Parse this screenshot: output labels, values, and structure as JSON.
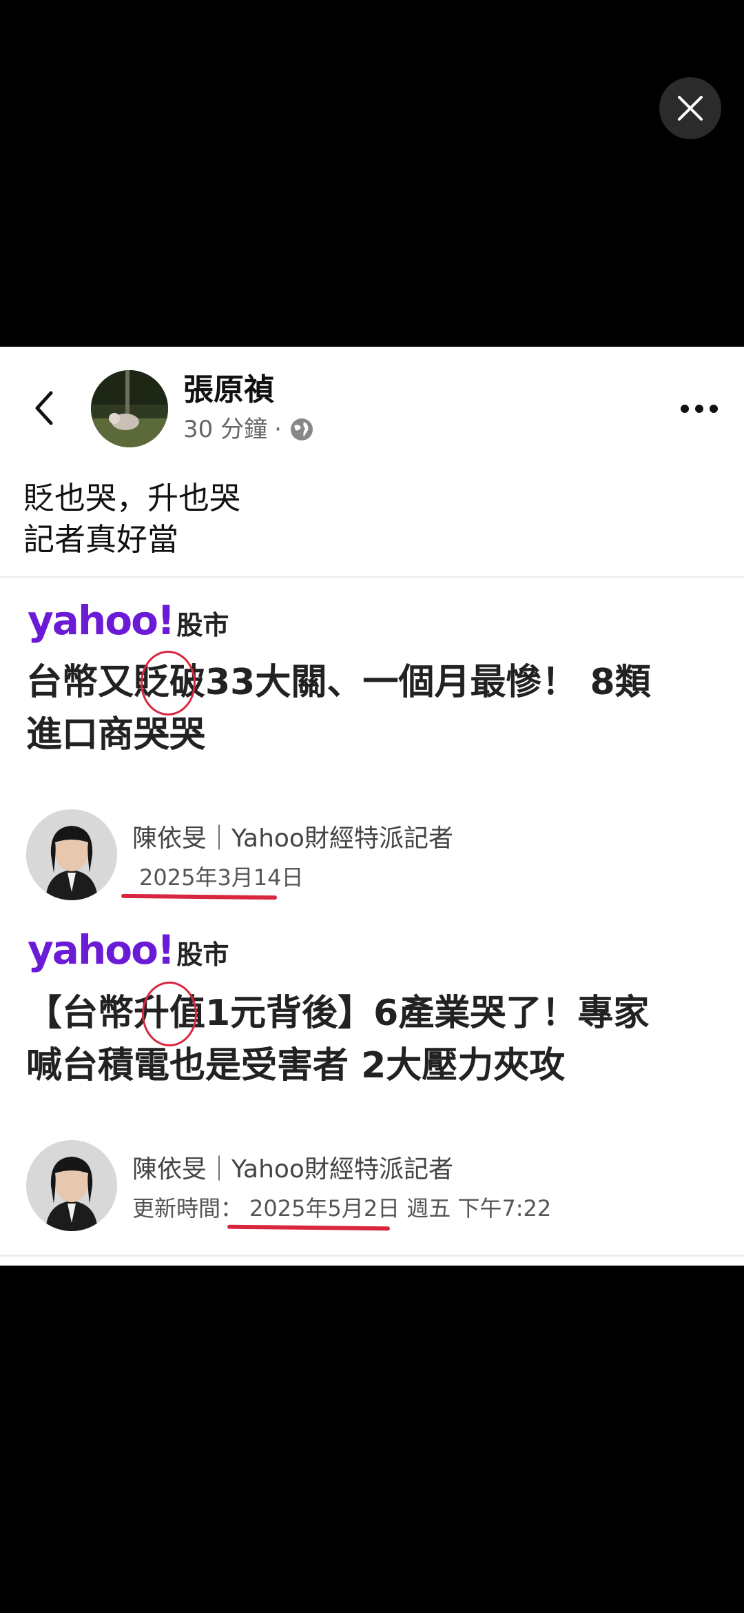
{
  "viewer": {
    "close_icon": "close-icon"
  },
  "post": {
    "author": "張原禎",
    "time_ago": "30 分鐘",
    "separator": "·",
    "audience_icon": "globe-icon",
    "text_lines": [
      "貶也哭，升也哭",
      "記者真好當"
    ]
  },
  "articles": [
    {
      "logo_text": "yahoo!",
      "section": "股市",
      "headline_lines": [
        "台幣又貶破33大關、一個月最慘！ 8類",
        "進口商哭哭"
      ],
      "reporter": "陳依旻｜Yahoo財經特派記者",
      "date_label": "",
      "date": "2025年3月14日",
      "date_extra": ""
    },
    {
      "logo_text": "yahoo!",
      "section": "股市",
      "headline_lines": [
        "【台幣升值1元背後】6產業哭了！專家",
        "喊台積電也是受害者 2大壓力夾攻"
      ],
      "reporter": "陳依旻｜Yahoo財經特派記者",
      "date_label": "更新時間：",
      "date": "2025年5月2日",
      "date_extra": "週五 下午7:22"
    }
  ],
  "colors": {
    "yahoo_purple": "#6b1bd6",
    "annotation_red": "#d7263d"
  }
}
